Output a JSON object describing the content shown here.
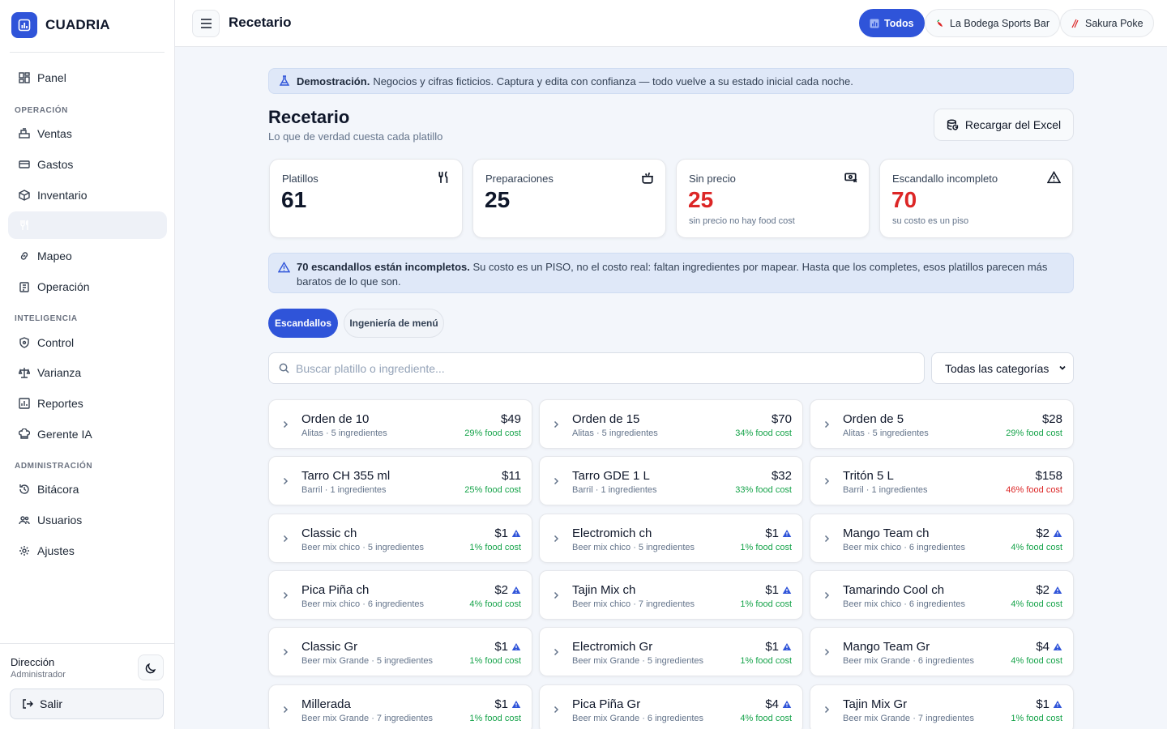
{
  "brand": {
    "name": "CUADRIA"
  },
  "sidebar": {
    "panel": "Panel",
    "sections": {
      "operacion": "OPERACIÓN",
      "inteligencia": "INTELIGENCIA",
      "administracion": "ADMINISTRACIÓN"
    },
    "items": {
      "ventas": "Ventas",
      "gastos": "Gastos",
      "inventario": "Inventario",
      "recetario": "Recetario",
      "mapeo": "Mapeo",
      "operacion": "Operación",
      "control": "Control",
      "varianza": "Varianza",
      "reportes": "Reportes",
      "gerente": "Gerente IA",
      "bitacora": "Bitácora",
      "usuarios": "Usuarios",
      "ajustes": "Ajustes"
    },
    "user": {
      "name": "Dirección",
      "role": "Administrador"
    },
    "logout": "Salir"
  },
  "topbar": {
    "title": "Recetario",
    "businesses": [
      "Todos",
      "La Bodega Sports Bar",
      "Sakura Poke"
    ]
  },
  "demo_banner": {
    "bold": "Demostración.",
    "text": "Negocios y cifras ficticios. Captura y edita con confianza — todo vuelve a su estado inicial cada noche."
  },
  "page": {
    "title": "Recetario",
    "subtitle": "Lo que de verdad cuesta cada platillo",
    "reload": "Recargar del Excel"
  },
  "stats": [
    {
      "label": "Platillos",
      "value": "61",
      "note": ""
    },
    {
      "label": "Preparaciones",
      "value": "25",
      "note": ""
    },
    {
      "label": "Sin precio",
      "value": "25",
      "note": "sin precio no hay food cost"
    },
    {
      "label": "Escandallo incompleto",
      "value": "70",
      "note": "su costo es un piso"
    }
  ],
  "warning": {
    "bold": "70 escandallos están incompletos.",
    "text": "Su costo es un PISO, no el costo real: faltan ingredientes por mapear. Hasta que los completes, esos platillos parecen más baratos de lo que son."
  },
  "tabs": [
    "Escandallos",
    "Ingeniería de menú"
  ],
  "search": {
    "placeholder": "Buscar platillo o ingrediente...",
    "value": ""
  },
  "category_filter": {
    "selected": "Todas las categorías"
  },
  "colors": {
    "accent": "#2f54d9",
    "good": "#16a34a",
    "bad": "#dc2626"
  },
  "recipes": [
    {
      "name": "Orden de 10",
      "meta": "Alitas · 5 ingredientes",
      "price": "$49",
      "fc": "29% food cost",
      "warn": false,
      "high": false
    },
    {
      "name": "Orden de 15",
      "meta": "Alitas · 5 ingredientes",
      "price": "$70",
      "fc": "34% food cost",
      "warn": false,
      "high": false
    },
    {
      "name": "Orden de 5",
      "meta": "Alitas · 5 ingredientes",
      "price": "$28",
      "fc": "29% food cost",
      "warn": false,
      "high": false
    },
    {
      "name": "Tarro CH 355 ml",
      "meta": "Barril · 1 ingredientes",
      "price": "$11",
      "fc": "25% food cost",
      "warn": false,
      "high": false
    },
    {
      "name": "Tarro GDE 1 L",
      "meta": "Barril · 1 ingredientes",
      "price": "$32",
      "fc": "33% food cost",
      "warn": false,
      "high": false
    },
    {
      "name": "Tritón 5 L",
      "meta": "Barril · 1 ingredientes",
      "price": "$158",
      "fc": "46% food cost",
      "warn": false,
      "high": true
    },
    {
      "name": "Classic ch",
      "meta": "Beer mix chico · 5 ingredientes",
      "price": "$1",
      "fc": "1% food cost",
      "warn": true,
      "high": false
    },
    {
      "name": "Electromich ch",
      "meta": "Beer mix chico · 5 ingredientes",
      "price": "$1",
      "fc": "1% food cost",
      "warn": true,
      "high": false
    },
    {
      "name": "Mango Team ch",
      "meta": "Beer mix chico · 6 ingredientes",
      "price": "$2",
      "fc": "4% food cost",
      "warn": true,
      "high": false
    },
    {
      "name": "Pica Piña ch",
      "meta": "Beer mix chico · 6 ingredientes",
      "price": "$2",
      "fc": "4% food cost",
      "warn": true,
      "high": false
    },
    {
      "name": "Tajin Mix ch",
      "meta": "Beer mix chico · 7 ingredientes",
      "price": "$1",
      "fc": "1% food cost",
      "warn": true,
      "high": false
    },
    {
      "name": "Tamarindo Cool ch",
      "meta": "Beer mix chico · 6 ingredientes",
      "price": "$2",
      "fc": "4% food cost",
      "warn": true,
      "high": false
    },
    {
      "name": "Classic Gr",
      "meta": "Beer mix Grande · 5 ingredientes",
      "price": "$1",
      "fc": "1% food cost",
      "warn": true,
      "high": false
    },
    {
      "name": "Electromich Gr",
      "meta": "Beer mix Grande · 5 ingredientes",
      "price": "$1",
      "fc": "1% food cost",
      "warn": true,
      "high": false
    },
    {
      "name": "Mango Team Gr",
      "meta": "Beer mix Grande · 6 ingredientes",
      "price": "$4",
      "fc": "4% food cost",
      "warn": true,
      "high": false
    },
    {
      "name": "Millerada",
      "meta": "Beer mix Grande · 7 ingredientes",
      "price": "$1",
      "fc": "1% food cost",
      "warn": true,
      "high": false
    },
    {
      "name": "Pica Piña Gr",
      "meta": "Beer mix Grande · 6 ingredientes",
      "price": "$4",
      "fc": "4% food cost",
      "warn": true,
      "high": false
    },
    {
      "name": "Tajin Mix Gr",
      "meta": "Beer mix Grande · 7 ingredientes",
      "price": "$1",
      "fc": "1% food cost",
      "warn": true,
      "high": false
    }
  ]
}
